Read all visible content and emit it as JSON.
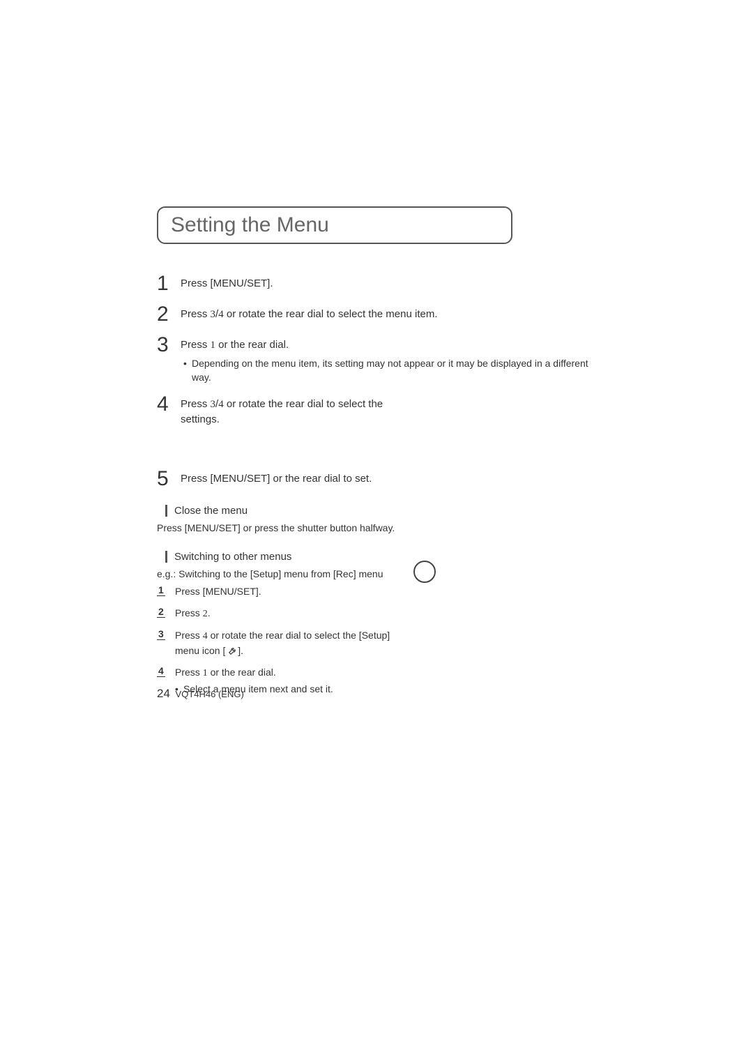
{
  "title": "Setting the Menu",
  "steps": {
    "s1": {
      "num": "1",
      "text": "Press [MENU/SET]."
    },
    "s2": {
      "num": "2",
      "text_a": "Press ",
      "sym1": "3",
      "mid": "/",
      "sym2": "4",
      "text_b": " or rotate the rear dial to select the menu item."
    },
    "s3": {
      "num": "3",
      "text_a": "Press ",
      "sym1": "1",
      "text_b": " or the rear dial.",
      "bullet": "Depending on the menu item, its setting may not appear or it may be displayed in a different way."
    },
    "s4": {
      "num": "4",
      "text_a": "Press ",
      "sym1": "3",
      "mid": "/",
      "sym2": "4",
      "text_b": " or rotate the rear dial to select the settings."
    },
    "s5": {
      "num": "5",
      "text": "Press [MENU/SET] or the rear dial to set."
    }
  },
  "close": {
    "head": "Close the menu",
    "text": "Press [MENU/SET] or press the shutter button halfway."
  },
  "switch": {
    "head": "Switching to other menus",
    "eg": "e.g.: Switching to the [Setup] menu from [Rec] menu",
    "mini": {
      "m1": {
        "num": "1",
        "text": "Press [MENU/SET]."
      },
      "m2": {
        "num": "2",
        "text_a": "Press ",
        "sym1": "2",
        "text_b": "."
      },
      "m3": {
        "num": "3",
        "text_a": "Press ",
        "sym1": "4",
        "text_b": " or rotate the rear dial to select the [Setup] menu icon [",
        "text_c": "]."
      },
      "m4": {
        "num": "4",
        "text_a": "Press ",
        "sym1": "1",
        "text_b": " or the rear dial.",
        "bullet": "Select a menu item next and set it."
      }
    }
  },
  "footer": {
    "page": "24",
    "code": "VQT4H46 (ENG)"
  }
}
